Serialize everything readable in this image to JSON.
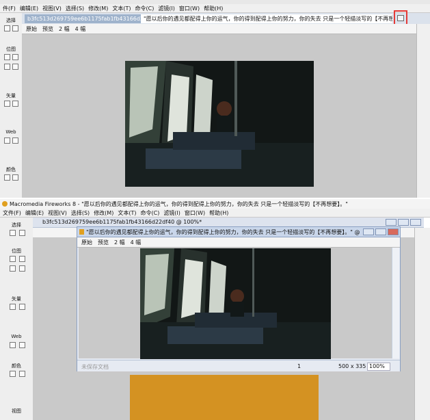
{
  "top": {
    "menu": [
      "件(F)",
      "编辑(E)",
      "视图(V)",
      "选择(S)",
      "修改(M)",
      "文本(T)",
      "命令(C)",
      "滤镜(I)",
      "窗口(W)",
      "帮助(H)"
    ],
    "tabs": [
      "b3fc513d269759ee6b1175fab1fb43166d22df40*",
      "\"愿以后你的遇见都配得上你的运气，你的得到配得上你的努力，你的失去 只是一个轻描淡写的【不再想要】。\""
    ],
    "view_tabs": [
      "原始",
      "预览",
      "2 幅",
      "4 幅"
    ]
  },
  "bottom": {
    "titlebar": "Macromedia Fireworks 8 - \"愿以后你的遇见都配得上你的运气，你的得到配得上你的努力，你的失去 只是一个轻描淡写的【不再想要】。\"",
    "menu": [
      "文件(F)",
      "编辑(E)",
      "视图(V)",
      "选择(S)",
      "修改(M)",
      "文本(T)",
      "命令(C)",
      "滤镜(I)",
      "窗口(W)",
      "帮助(H)"
    ],
    "doc_strip_title": "b3fc513d269759ee6b1175fab1fb43166d22df40 @ 100%*",
    "doc_window_title": "\"愿以后你的遇见都配得上你的运气，你的得到配得上你的努力，你的失去 只是一个轻描淡写的【不再想要】。\" @ 100%*",
    "view_tabs": [
      "原始",
      "预览",
      "2 幅",
      "4 幅"
    ],
    "status": {
      "left": "未保存文档",
      "page": "1",
      "size": "500 x 335",
      "zoom": "100%"
    }
  },
  "toolbox": {
    "top": [
      "选择",
      "位图",
      "矢量",
      "Web",
      "颜色"
    ],
    "bottom": [
      "选择",
      "位图",
      "矢量",
      "Web",
      "颜色",
      "视图"
    ]
  },
  "colors": {
    "highlight": "#e53935",
    "canvas_gray": "#c9c9c9",
    "orange_bg": "#d49222"
  },
  "icons": [
    "cursor-icon",
    "crop-icon",
    "lasso-icon",
    "brush-icon",
    "pen-icon",
    "text-icon",
    "eraser-icon",
    "eyedropper-icon",
    "restore-window-icon",
    "minimize-icon",
    "maximize-icon",
    "close-icon"
  ]
}
